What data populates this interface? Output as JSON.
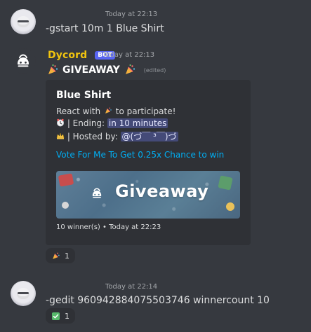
{
  "messages": [
    {
      "author": "",
      "timestamp": "Today at 22:13",
      "text": "-gstart 10m 1 Blue Shirt"
    },
    {
      "author": "Dycord",
      "badge": "BOT",
      "timestamp": "Today at 22:13",
      "title": "GIVEAWAY",
      "edited": "(edited)",
      "embed": {
        "title": "Blue Shirt",
        "line1": "React with",
        "line1_suffix": "to participate!",
        "line2": "| Ending:",
        "line2_value": "in 10 minutes",
        "line3": "| Hosted by:",
        "line3_value": "@(づ￣ ³￣)づ",
        "vote_link": "Vote For Me To Get 0.25x Chance to win",
        "banner_text": "Giveaway",
        "footer": "10 winner(s) • Today at 22:23"
      },
      "reaction": {
        "icon": "party-popper-icon",
        "count": "1"
      }
    },
    {
      "author": "",
      "timestamp": "Today at 22:14",
      "text": "-gedit 960942884075503746 winnercount 10",
      "reaction": {
        "icon": "green-check-icon",
        "count": "1"
      }
    }
  ],
  "colors": {
    "background": "#36393f",
    "embed_background": "#2f3136",
    "link": "#00aff4",
    "bot_name": "#f1c40f",
    "badge": "#5865f2",
    "banner": "#5a7f96"
  }
}
